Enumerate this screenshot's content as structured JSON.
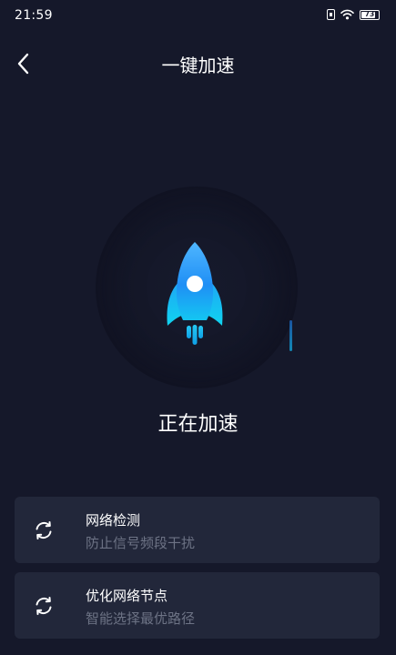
{
  "status_bar": {
    "time": "21:59",
    "battery_level": "73"
  },
  "header": {
    "title": "一键加速"
  },
  "main": {
    "status_text": "正在加速"
  },
  "tasks": [
    {
      "title": "网络检测",
      "subtitle": "防止信号频段干扰"
    },
    {
      "title": "优化网络节点",
      "subtitle": "智能选择最优路径"
    }
  ],
  "colors": {
    "background": "#15182a",
    "card": "#22273a",
    "accent": "#1f9ef0",
    "muted_text": "#6d7385"
  },
  "icons": [
    "back-icon",
    "sim-icon",
    "wifi-icon",
    "battery-icon",
    "rocket-icon",
    "refresh-icon"
  ]
}
